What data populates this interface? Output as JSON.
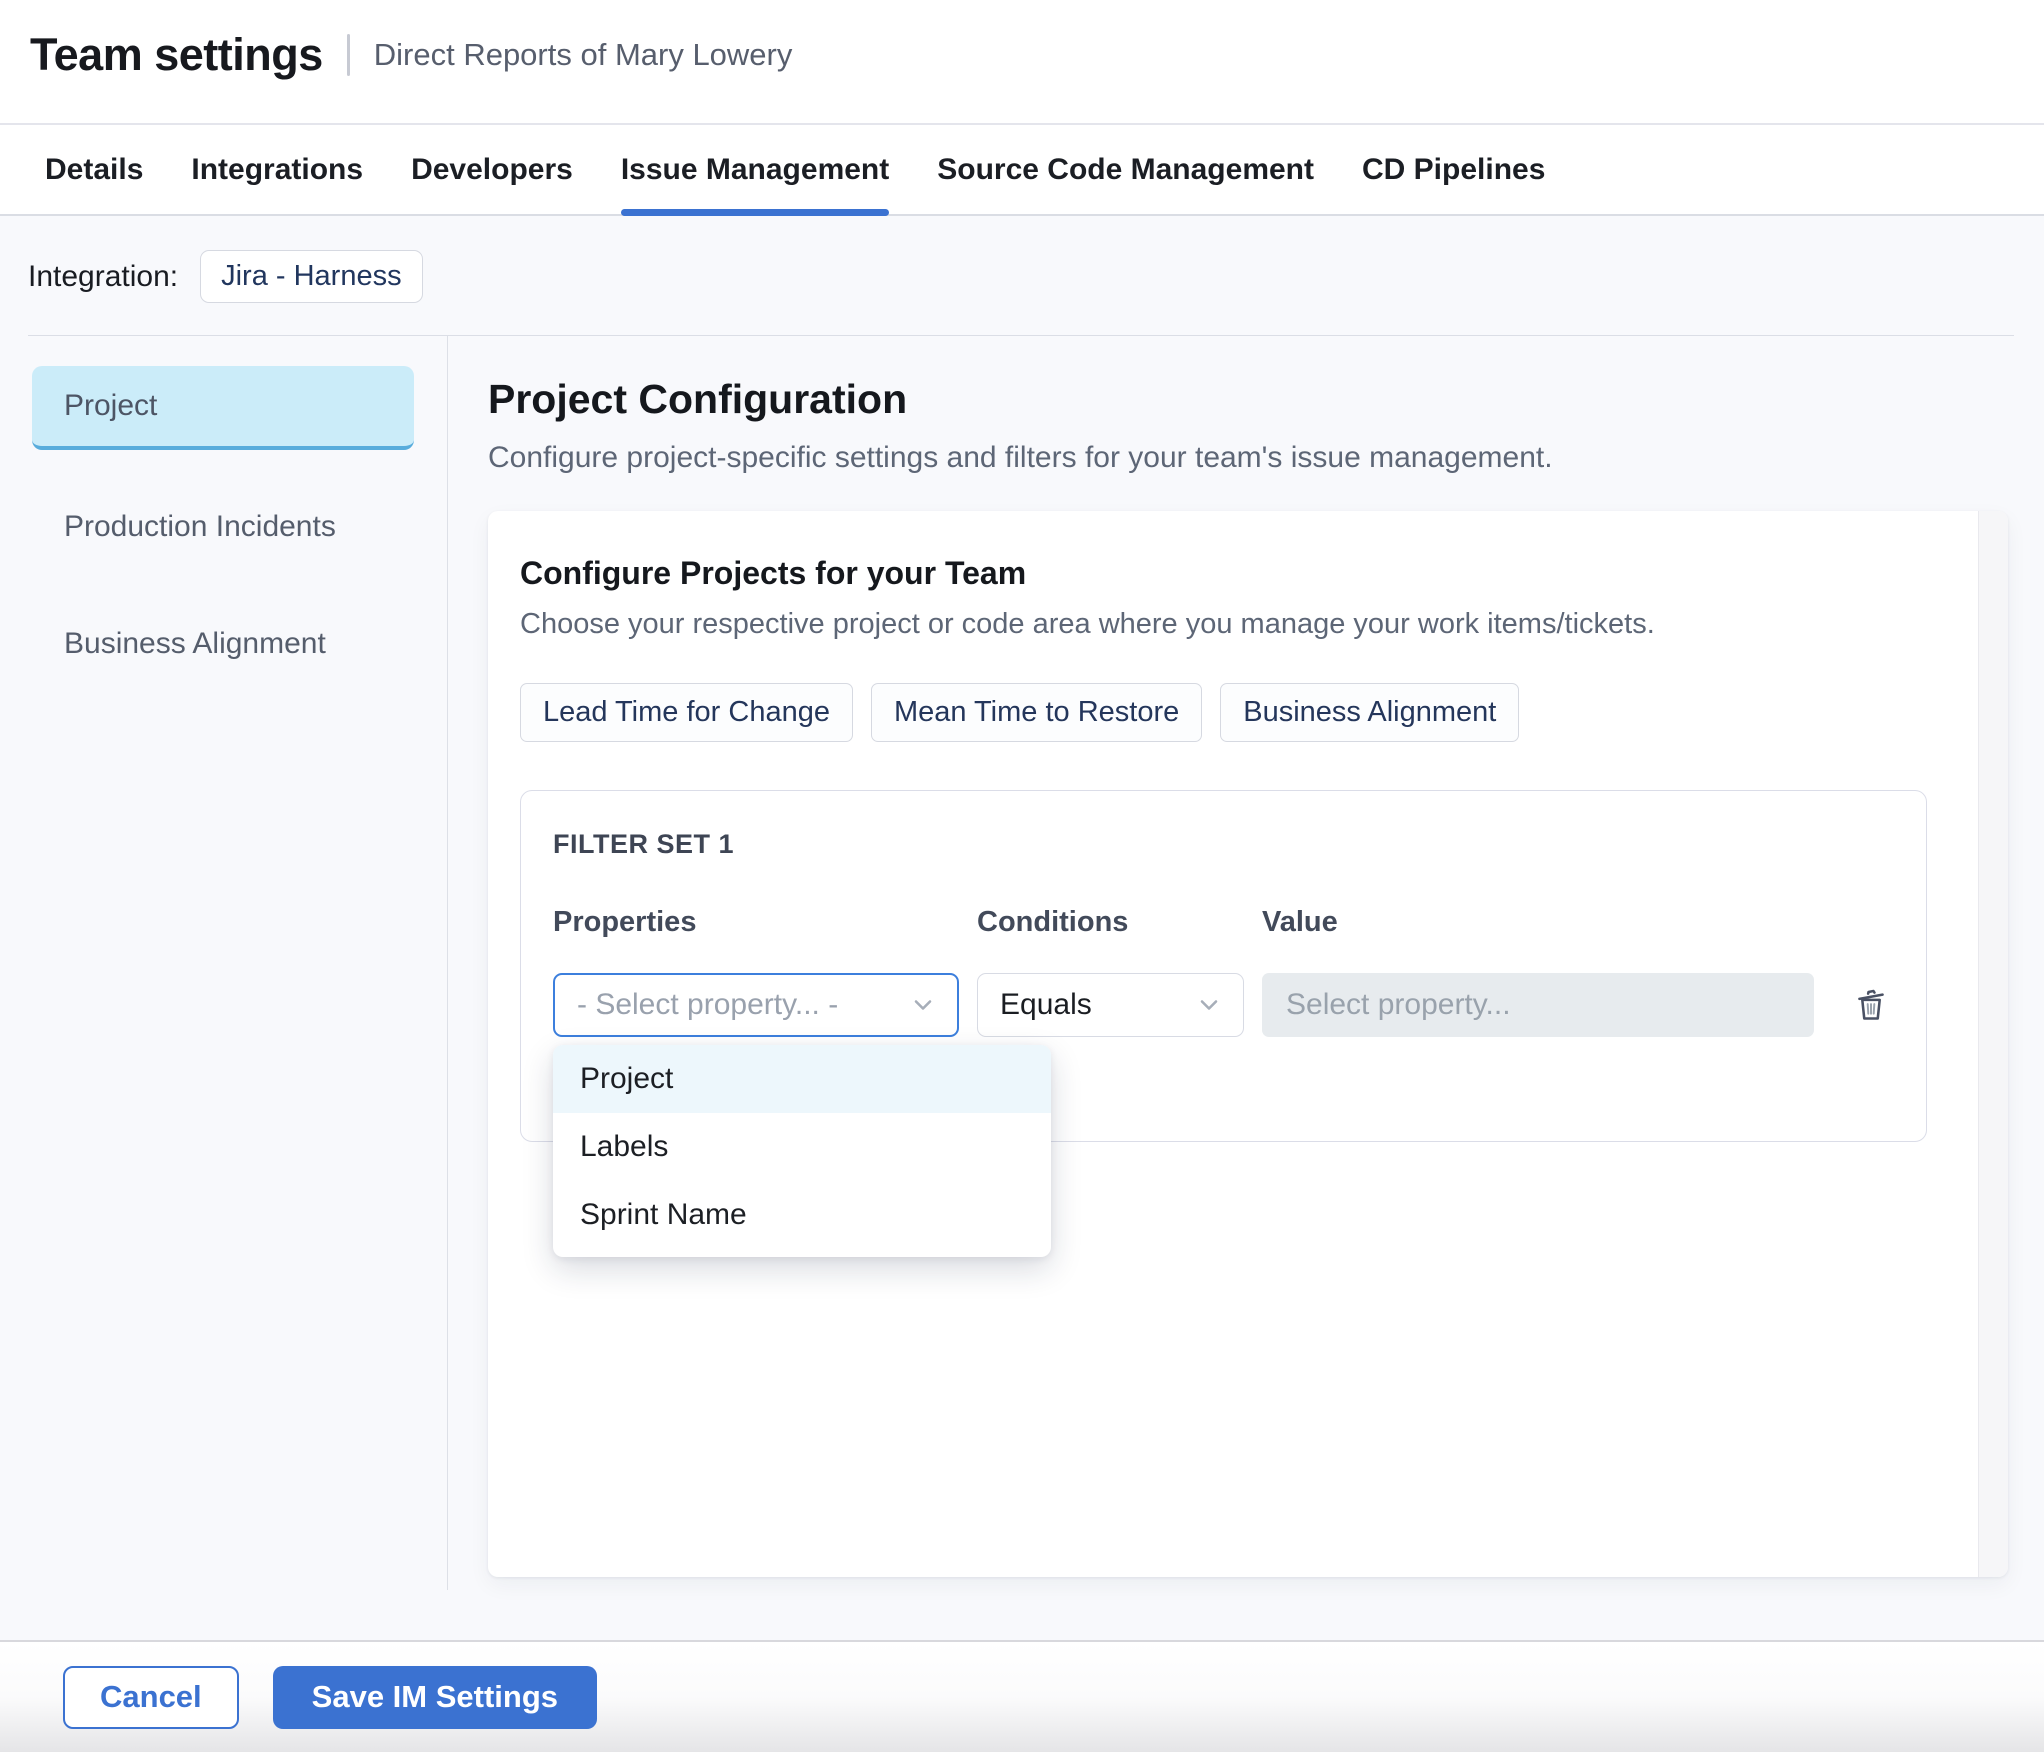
{
  "header": {
    "title": "Team settings",
    "subtitle": "Direct Reports of Mary Lowery"
  },
  "tabs": {
    "active_tab": "Issue Management",
    "items": [
      {
        "label": "Details"
      },
      {
        "label": "Integrations"
      },
      {
        "label": "Developers"
      },
      {
        "label": "Issue Management"
      },
      {
        "label": "Source Code Management"
      },
      {
        "label": "CD Pipelines"
      }
    ]
  },
  "integration": {
    "label": "Integration:",
    "badge": "Jira - Harness"
  },
  "sidebar": {
    "items": [
      {
        "label": "Project",
        "active": true
      },
      {
        "label": "Production Incidents",
        "active": false
      },
      {
        "label": "Business Alignment",
        "active": false
      }
    ]
  },
  "main": {
    "title": "Project Configuration",
    "subtitle": "Configure project-specific settings and filters for your team's issue management.",
    "card": {
      "title": "Configure Projects for your Team",
      "subtitle": "Choose your respective project or code area where you manage your work items/tickets.",
      "chips": [
        "Lead Time for Change",
        "Mean Time to Restore",
        "Business Alignment"
      ],
      "filter_set": {
        "title": "FILTER SET 1",
        "columns": [
          "Properties",
          "Conditions",
          "Value"
        ],
        "property_placeholder": "- Select property... -",
        "condition_value": "Equals",
        "value_placeholder": "Select property...",
        "dropdown_options": [
          {
            "label": "Project",
            "highlighted": true
          },
          {
            "label": "Labels",
            "highlighted": false
          },
          {
            "label": "Sprint Name",
            "highlighted": false
          }
        ]
      }
    }
  },
  "footer": {
    "cancel_label": "Cancel",
    "save_label": "Save IM Settings"
  },
  "colors": {
    "accent": "#3b72d1",
    "page_bg": "#f8f9fc",
    "sidebar_active_bg": "#cbecf9",
    "sidebar_active_border": "#58acdc",
    "focus_border": "#3c7fdd",
    "dropdown_highlight": "#edf7fc"
  }
}
